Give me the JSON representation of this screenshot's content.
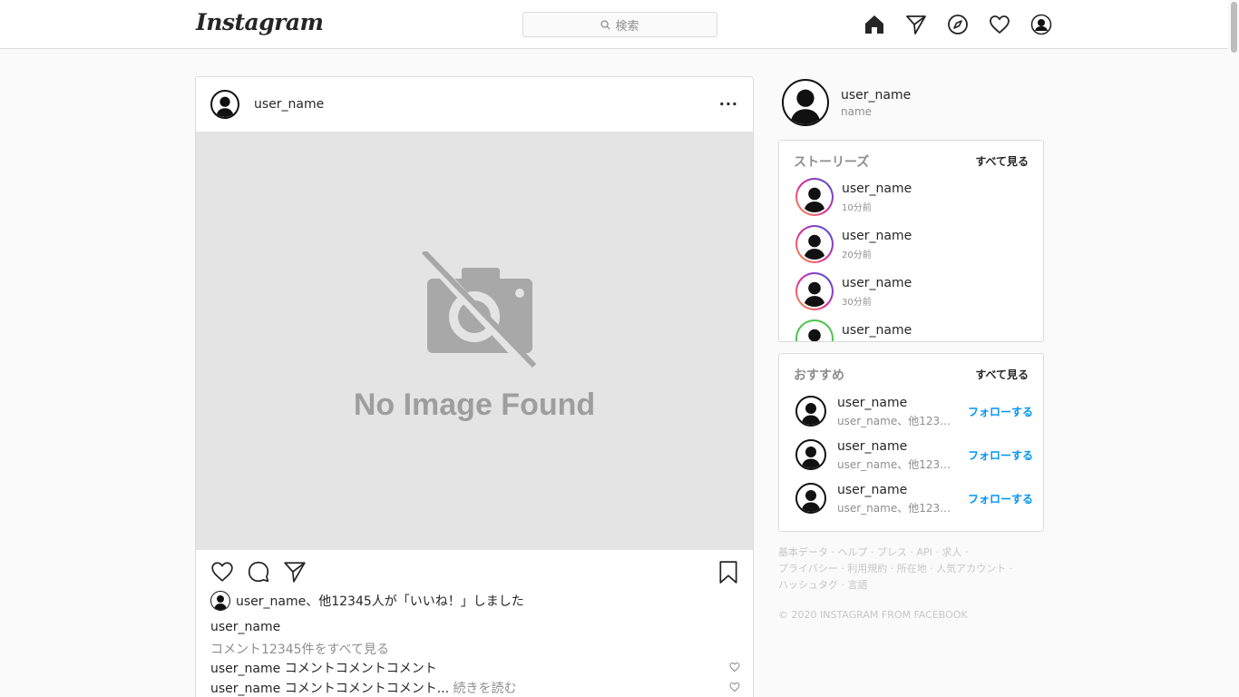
{
  "header": {
    "logo": "Instagram",
    "search_placeholder": "検索",
    "nav_icons": [
      "home-icon",
      "direct-icon",
      "explore-icon",
      "activity-icon",
      "profile-icon"
    ]
  },
  "post": {
    "user_name": "user_name",
    "more_label": "···",
    "image_text": "No Image Found",
    "likes_text": "user_name、他12345人が「いいね！」しました",
    "author": "user_name",
    "view_all_comments": "コメント12345件をすべて見る",
    "comments": [
      {
        "user": "user_name",
        "text": "コメントコメントコメント",
        "more": ""
      },
      {
        "user": "user_name",
        "text": "コメントコメントコメント...",
        "more": "続きを読む"
      }
    ]
  },
  "sidebar": {
    "me": {
      "user_name": "user_name",
      "name": "name"
    },
    "stories": {
      "title": "ストーリーズ",
      "see_all": "すべて見る",
      "items": [
        {
          "user": "user_name",
          "time": "10分前",
          "ring": "pink"
        },
        {
          "user": "user_name",
          "time": "20分前",
          "ring": "pink"
        },
        {
          "user": "user_name",
          "time": "30分前",
          "ring": "pink"
        },
        {
          "user": "user_name",
          "time": "",
          "ring": "green"
        }
      ]
    },
    "suggestions": {
      "title": "おすすめ",
      "see_all": "すべて見る",
      "items": [
        {
          "user": "user_name",
          "sub": "user_name、他123人...",
          "follow": "フォローする"
        },
        {
          "user": "user_name",
          "sub": "user_name、他123人...",
          "follow": "フォローする"
        },
        {
          "user": "user_name",
          "sub": "user_name、他123人...",
          "follow": "フォローする"
        }
      ]
    },
    "footer": {
      "links_line1": "基本データ · ヘルプ · プレス · API · 求人 ·",
      "links_line2": "プライバシー · 利用規約 · 所在地 · 人気アカウント ·",
      "links_line3": "ハッシュタグ · 言語",
      "copyright": "© 2020 INSTAGRAM FROM FACEBOOK"
    }
  },
  "colors": {
    "link_blue": "#0095f6",
    "story_ring_pink": "#d6249f",
    "story_ring_orange": "#fd9a3a",
    "story_ring_green": "#4cc34c"
  }
}
